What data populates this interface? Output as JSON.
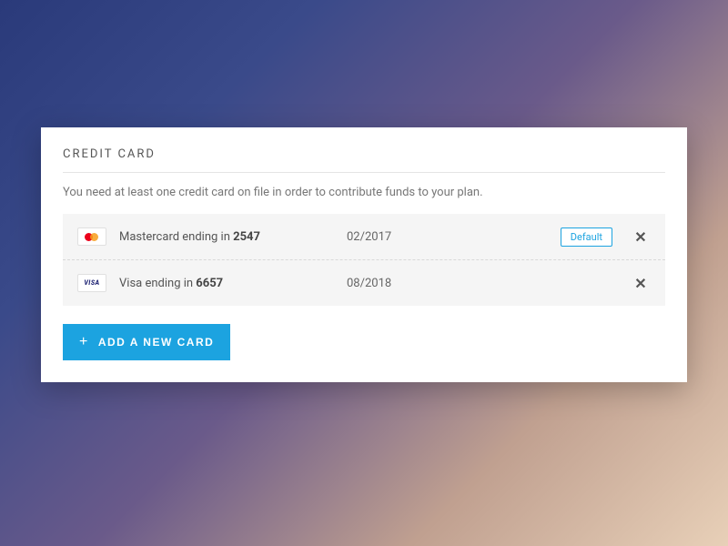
{
  "section": {
    "title": "CREDIT CARD",
    "description": "You need at least one credit card on file in order to contribute funds to your plan."
  },
  "cards": [
    {
      "brand": "mastercard",
      "label_prefix": "Mastercard ending in ",
      "last4": "2547",
      "expiry": "02/2017",
      "default_label": "Default",
      "is_default": true
    },
    {
      "brand": "visa",
      "label_prefix": "Visa ending in ",
      "last4": "6657",
      "expiry": "08/2018",
      "default_label": "",
      "is_default": false
    }
  ],
  "actions": {
    "add_card_label": "ADD A NEW CARD"
  }
}
